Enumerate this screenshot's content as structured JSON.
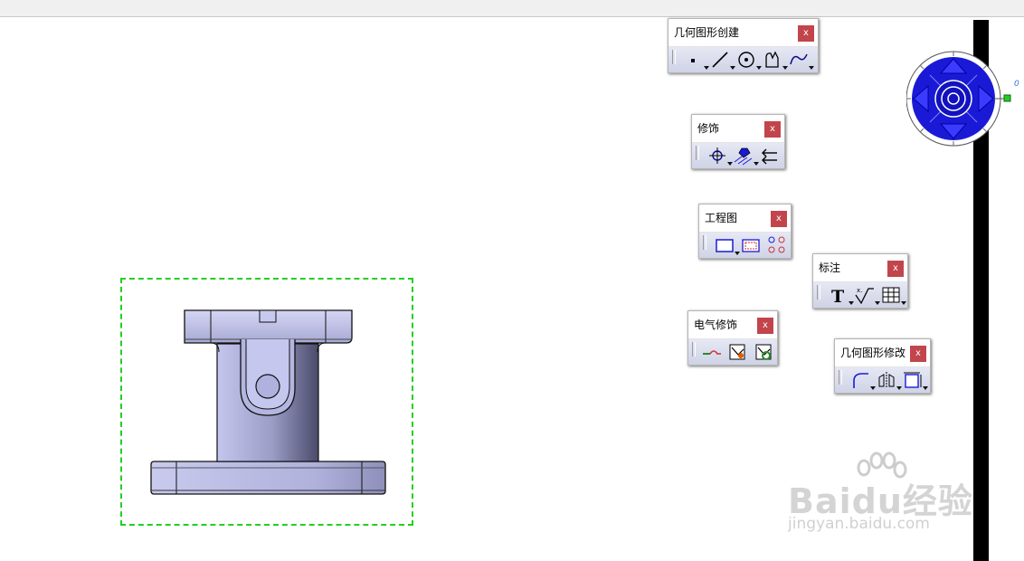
{
  "toolbars": [
    {
      "id": "geometry-creation",
      "title": "几何图形创建",
      "close_label": "x",
      "tools": [
        "point-icon",
        "line-icon",
        "circle-icon",
        "profile-icon",
        "curve-icon"
      ]
    },
    {
      "id": "dress-up",
      "title": "修饰",
      "close_label": "x",
      "tools": [
        "center-line-icon",
        "area-fill-icon",
        "arrow-icon"
      ]
    },
    {
      "id": "drawing",
      "title": "工程图",
      "close_label": "x",
      "tools": [
        "new-sheet-icon",
        "new-view-icon",
        "instantiate-2d-component-icon"
      ]
    },
    {
      "id": "annotation",
      "title": "标注",
      "close_label": "x",
      "tools": [
        "text-icon",
        "roughness-symbol-icon",
        "table-icon"
      ]
    },
    {
      "id": "electrical-dress-up",
      "title": "电气修饰",
      "close_label": "x",
      "tools": [
        "wire-icon",
        "bundle-icon",
        "connector-icon"
      ]
    },
    {
      "id": "geometry-modification",
      "title": "几何图形修改",
      "close_label": "x",
      "tools": [
        "corner-icon",
        "symmetry-icon",
        "transformation-icon"
      ]
    }
  ],
  "compass": {
    "label": "0"
  },
  "drawing": {
    "selection_color": "#22d022",
    "part_color": "#b8b9e0"
  },
  "watermark": {
    "main": "Baidu经验",
    "sub": "jingyan.baidu.com"
  },
  "colors": {
    "close_button": "#c2454c",
    "compass_blue": "#1a1ad6",
    "toolbar_bg": "#d8dbec"
  }
}
